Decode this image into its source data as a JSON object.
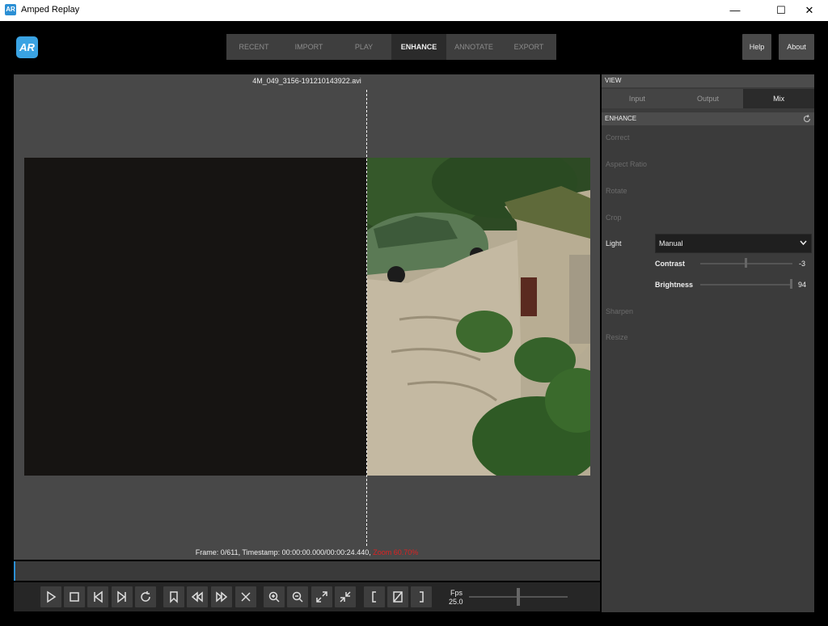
{
  "window": {
    "title": "Amped Replay",
    "icon_text": "AR",
    "controls": [
      "minimize-icon",
      "maximize-icon",
      "close-icon"
    ]
  },
  "app": {
    "logo_text": "AR"
  },
  "nav": {
    "tabs": [
      {
        "label": "RECENT",
        "active": false
      },
      {
        "label": "IMPORT",
        "active": false
      },
      {
        "label": "PLAY",
        "active": false
      },
      {
        "label": "ENHANCE",
        "active": true
      },
      {
        "label": "ANNOTATE",
        "active": false
      },
      {
        "label": "EXPORT",
        "active": false
      }
    ],
    "help_label": "Help",
    "about_label": "About"
  },
  "viewer": {
    "filename": "4M_049_3156-191210143922.avi",
    "status_text": "Frame: 0/611, Timestamp: 00:00:00.000/00:00:24.440,",
    "zoom_text": "Zoom 60.70%",
    "timeline_position": 0
  },
  "player_controls": {
    "buttons": [
      "play-icon",
      "stop-icon",
      "previous-frame-icon",
      "next-frame-icon",
      "loop-icon",
      "bookmark-icon",
      "rewind-icon",
      "fast-forward-icon",
      "clear-icon",
      "zoom-in-icon",
      "zoom-out-icon",
      "fit-expand-icon",
      "fit-shrink-icon",
      "mark-in-icon",
      "clear-marks-icon",
      "mark-out-icon"
    ],
    "fps_label": "Fps",
    "fps_value": "25.0",
    "fps_slider_fraction": 0.48
  },
  "panel": {
    "view_header": "VIEW",
    "view_tabs": [
      {
        "label": "Input",
        "active": false
      },
      {
        "label": "Output",
        "active": false
      },
      {
        "label": "Mix",
        "active": true
      }
    ],
    "enhance_header": "ENHANCE",
    "filters": {
      "correct": "Correct",
      "aspect_ratio": "Aspect Ratio",
      "rotate": "Rotate",
      "crop": "Crop",
      "light": "Light",
      "sharpen": "Sharpen",
      "resize": "Resize"
    },
    "light": {
      "mode": "Manual",
      "contrast_label": "Contrast",
      "contrast_value": "-3",
      "contrast_fraction": 0.48,
      "brightness_label": "Brightness",
      "brightness_value": "94",
      "brightness_fraction": 0.97
    }
  },
  "colors": {
    "accent": "#2b8fd4",
    "zoom_text": "#d22222",
    "background": "#000000",
    "panel": "#3b3b3b"
  }
}
